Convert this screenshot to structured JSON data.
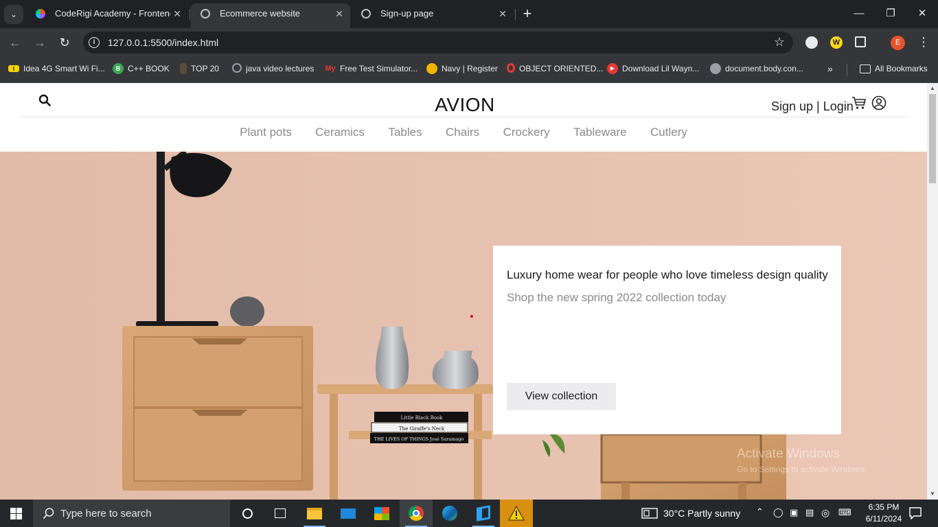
{
  "browser": {
    "tabs": [
      {
        "title": "CodeRigi Academy - Frontend D",
        "active": false
      },
      {
        "title": "Ecommerce website",
        "active": true
      },
      {
        "title": "Sign-up page",
        "active": false
      }
    ],
    "url": "127.0.0.1:5500/index.html",
    "profile_initial": "E",
    "bookmarks": [
      {
        "label": "Idea 4G Smart Wi Fi...",
        "icon": "idea-icon"
      },
      {
        "label": "C++ BOOK",
        "icon": "b-icon"
      },
      {
        "label": "TOP 20",
        "icon": "top20-icon"
      },
      {
        "label": "java video lectures",
        "icon": "github-icon"
      },
      {
        "label": "Free Test Simulator...",
        "icon": "my-icon"
      },
      {
        "label": "Navy | Register",
        "icon": "navy-icon"
      },
      {
        "label": "OBJECT ORIENTED...",
        "icon": "opera-icon"
      },
      {
        "label": "Download Lil Wayn...",
        "icon": "youtube-icon"
      },
      {
        "label": "document.body.con...",
        "icon": "globe-icon"
      }
    ],
    "all_bookmarks_label": "All Bookmarks"
  },
  "site": {
    "brand": "AVION",
    "auth_label": "Sign up | Login",
    "categories": [
      "Plant pots",
      "Ceramics",
      "Tables",
      "Chairs",
      "Crockery",
      "Tableware",
      "Cutlery"
    ],
    "hero": {
      "title": "Luxury home wear for people who love timeless design quality",
      "subtitle": "Shop the new spring 2022 collection today",
      "button": "View collection"
    }
  },
  "book_spines": [
    "Little Black Book",
    "The Giraffe's Neck",
    "THE LIVES OF THINGS  José Saramago"
  ],
  "watermark": {
    "title": "Activate Windows",
    "subtitle": "Go to Settings to activate Windows."
  },
  "taskbar": {
    "search_placeholder": "Type here to search",
    "weather": "30°C  Partly sunny",
    "time": "6:35 PM",
    "date": "6/11/2024"
  }
}
